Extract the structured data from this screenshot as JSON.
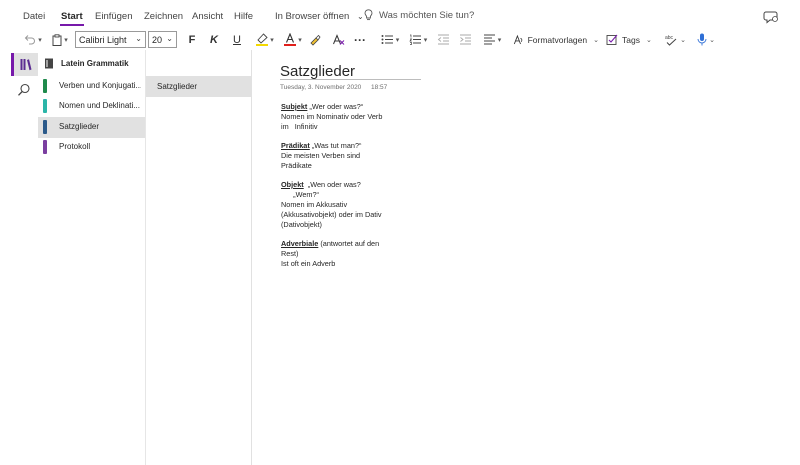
{
  "menu": {
    "tabs": [
      "Datei",
      "Start",
      "Einfügen",
      "Zeichnen",
      "Ansicht",
      "Hilfe"
    ],
    "active_tab": "Start",
    "open_in_browser": "In Browser öffnen",
    "tell_me_placeholder": "Was möchten Sie tun?"
  },
  "toolbar": {
    "font_name": "Calibri Light",
    "font_size": "20",
    "bold": "F",
    "italic": "K",
    "underline": "U",
    "more": "···",
    "styles_label": "Formatvorlagen",
    "tags_label": "Tags",
    "highlight_color": "#f4d900",
    "font_color": "#e0201b"
  },
  "notebook": {
    "title": "Latein Grammatik"
  },
  "sections": [
    {
      "label": "Verben und Konjugati...",
      "color": "#1f8a4c",
      "selected": false
    },
    {
      "label": "Nomen und Deklinati...",
      "color": "#2bb5a8",
      "selected": false
    },
    {
      "label": "Satzglieder",
      "color": "#2b5a8a",
      "selected": true
    },
    {
      "label": "Protokoll",
      "color": "#7b3fa0",
      "selected": false
    }
  ],
  "pages": [
    {
      "label": "Satzglieder",
      "selected": true
    }
  ],
  "page": {
    "title": "Satzglieder",
    "date": "Tuesday, 3. November 2020",
    "time": "18:57",
    "blocks": [
      {
        "term": "Subjekt",
        "rest": " „Wer oder was?“",
        "lines": [
          "Nomen im Nominativ oder Verb",
          "im   Infinitiv"
        ]
      },
      {
        "term": "Prädikat",
        "rest": " „Was tut man?“",
        "lines": [
          "Die meisten Verben sind",
          "Prädikate"
        ]
      },
      {
        "term": "Objekt",
        "rest": "  „Wen oder was?",
        "lines": [
          "      „Wem?“",
          "Nomen im Akkusativ",
          "(Akkusativobjekt) oder im Dativ",
          "(Dativobjekt)"
        ]
      },
      {
        "term": "Adverbiale",
        "rest": " (antwortet auf den",
        "lines": [
          "Rest)",
          "Ist oft ein Adverb"
        ]
      }
    ]
  },
  "colors": {
    "accent": "#7719aa",
    "selection": "#e1e1e1"
  }
}
